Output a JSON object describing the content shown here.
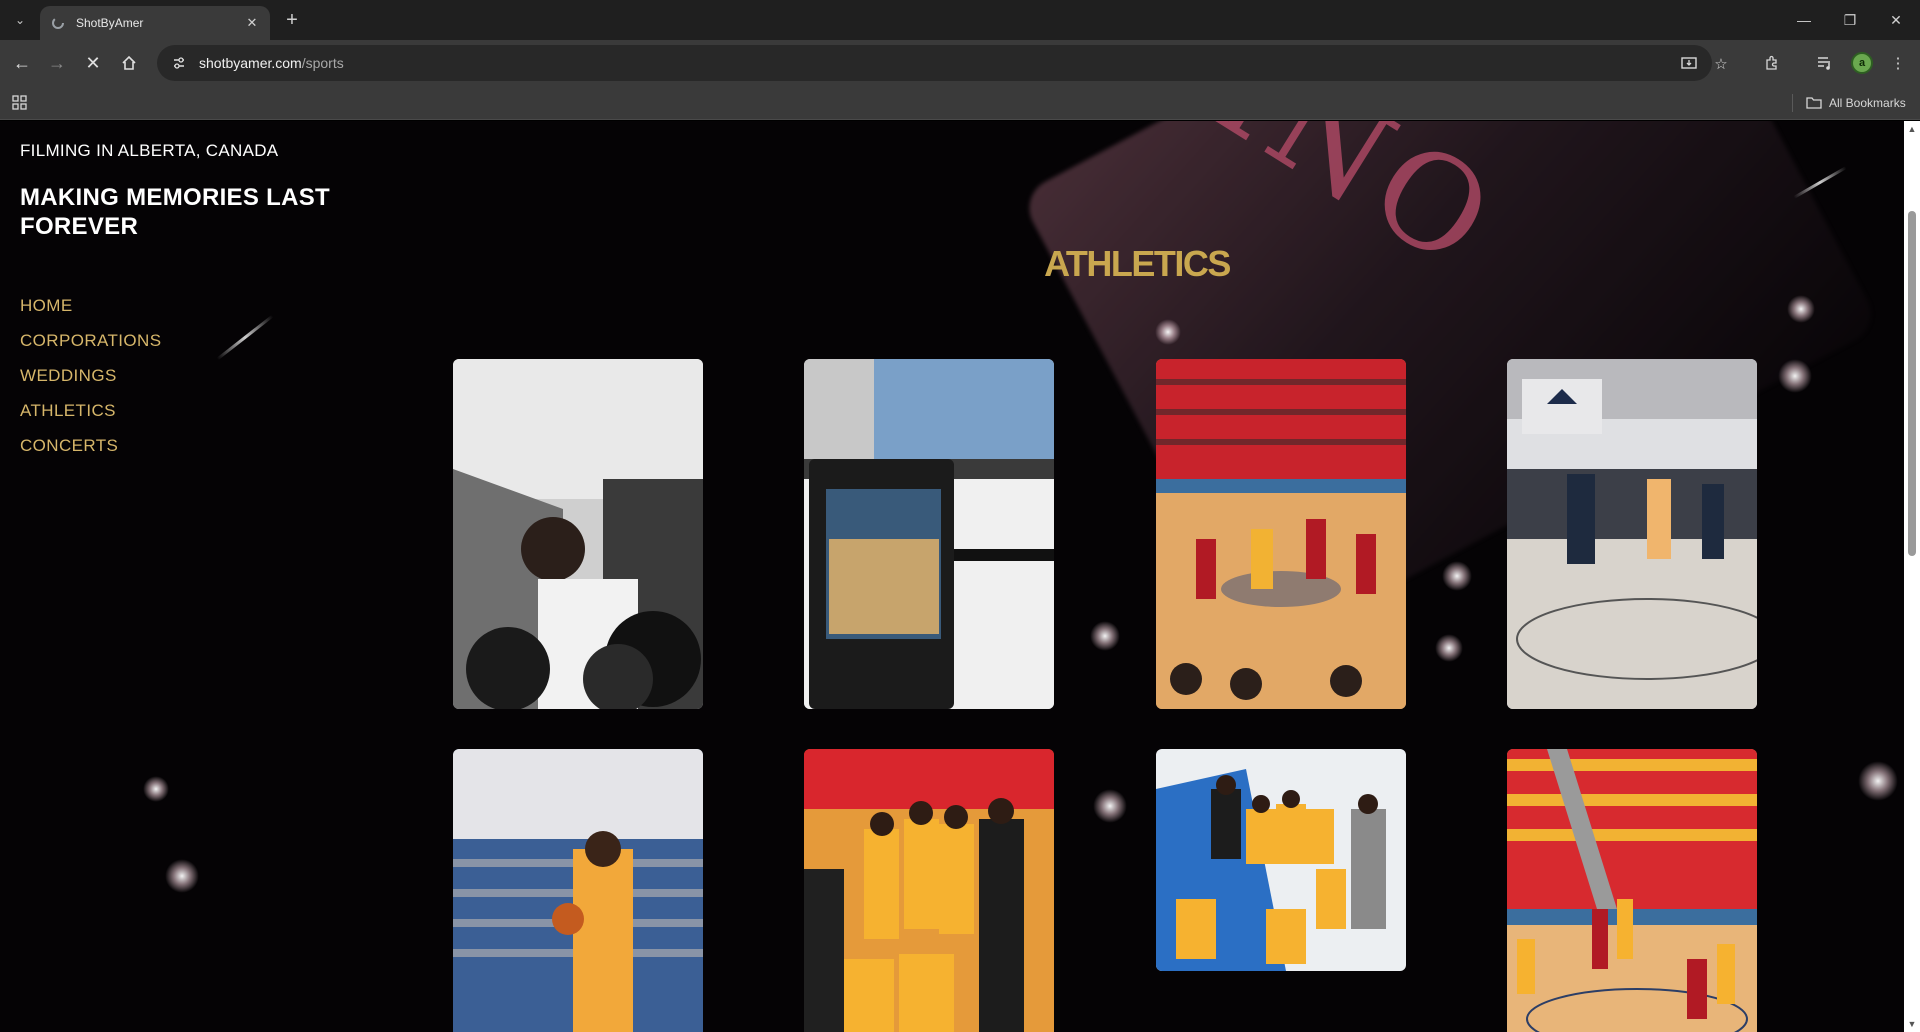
{
  "browser": {
    "tab_title": "ShotByAmer",
    "url_host": "shotbyamer.com",
    "url_path": "/sports",
    "all_bookmarks_label": "All Bookmarks",
    "profile_initial": "a"
  },
  "site": {
    "location": "FILMING IN ALBERTA, CANADA",
    "tagline": "MAKING MEMORIES LAST FOREVER",
    "nav": [
      {
        "label": "HOME"
      },
      {
        "label": "CORPORATIONS"
      },
      {
        "label": "WEDDINGS"
      },
      {
        "label": "ATHLETICS"
      },
      {
        "label": "CONCERTS"
      }
    ],
    "heading": "ATHLETICS",
    "accent_color": "#c9a74f",
    "nav_color": "#d6b66a"
  },
  "gallery": [
    {
      "subject": "athlete-gym-photo"
    },
    {
      "subject": "laptop-editing-photo"
    },
    {
      "subject": "basketball-game-red-seats-photo"
    },
    {
      "subject": "mount-royal-basketball-photo"
    },
    {
      "subject": "player-holding-ball-photo"
    },
    {
      "subject": "team-huddle-coach-photo"
    },
    {
      "subject": "team-huddle-overhead-photo"
    },
    {
      "subject": "basketball-shot-arena-photo"
    }
  ]
}
